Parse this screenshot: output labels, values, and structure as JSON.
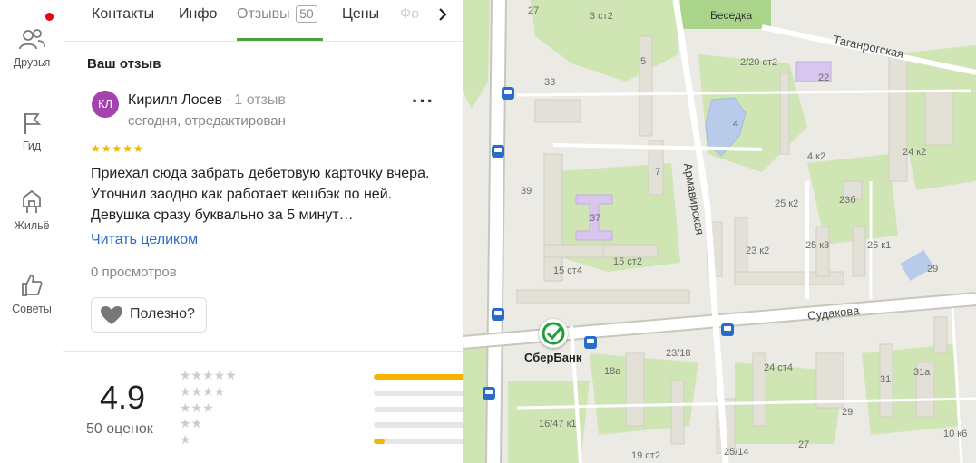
{
  "leftnav": {
    "items": [
      {
        "label": "Друзья",
        "icon": "friends-icon"
      },
      {
        "label": "Гид",
        "icon": "flag-icon"
      },
      {
        "label": "Жильё",
        "icon": "housing-icon"
      },
      {
        "label": "Советы",
        "icon": "thumbs-up-icon"
      }
    ]
  },
  "tabs": {
    "items": [
      "Контакты",
      "Инфо",
      "Отзывы",
      "Цены",
      "Фо"
    ],
    "reviews_count": "50",
    "active": "Отзывы"
  },
  "review": {
    "section_title": "Ваш отзыв",
    "avatar_initials": "КЛ",
    "author": "Кирилл Лосев",
    "author_reviews": "1 отзыв",
    "date": "сегодня, отредактирован",
    "stars": 5,
    "stars_glyphs": "★★★★★",
    "text": "Приехал сюда забрать дебетовую карточку вчера. Уточнил заодно как работает кешбэк по ней. Девушка сразу буквально за 5 минут…",
    "read_more": "Читать целиком",
    "views": "0 просмотров",
    "useful": "Полезно?"
  },
  "rating": {
    "value": "4.9",
    "count": "50 оценок",
    "distribution": [
      {
        "stars": 5,
        "glyphs": "★★★★★",
        "fraction": 0.98
      },
      {
        "stars": 4,
        "glyphs": "★★★★",
        "fraction": 0.0
      },
      {
        "stars": 3,
        "glyphs": "★★★",
        "fraction": 0.0
      },
      {
        "stars": 2,
        "glyphs": "★★",
        "fraction": 0.0
      },
      {
        "stars": 1,
        "glyphs": "★",
        "fraction": 0.06
      }
    ]
  },
  "map": {
    "streets": [
      "Таганрогская",
      "Армавирская",
      "Судакова"
    ],
    "poi": [
      "Беседка",
      "СберБанк"
    ],
    "buildings": [
      "27",
      "3 ст2",
      "2/20 ст2",
      "22",
      "5",
      "33",
      "4",
      "24 к2",
      "4 к2",
      "7",
      "39",
      "37",
      "23б",
      "25 к2",
      "23 к2",
      "25 к3",
      "25 к1",
      "15 ст2",
      "15 ст4",
      "29",
      "23/18",
      "24 ст4",
      "18а",
      "31",
      "31а",
      "16/47 к1",
      "29",
      "25/14",
      "19 ст2",
      "27",
      "10 к6"
    ],
    "colors": {
      "road": "#ffffff",
      "greenery": "#cfe6b4",
      "building": "#e3e0d7",
      "highlight": "#c8b8e8",
      "water": "#b9cbea"
    }
  }
}
